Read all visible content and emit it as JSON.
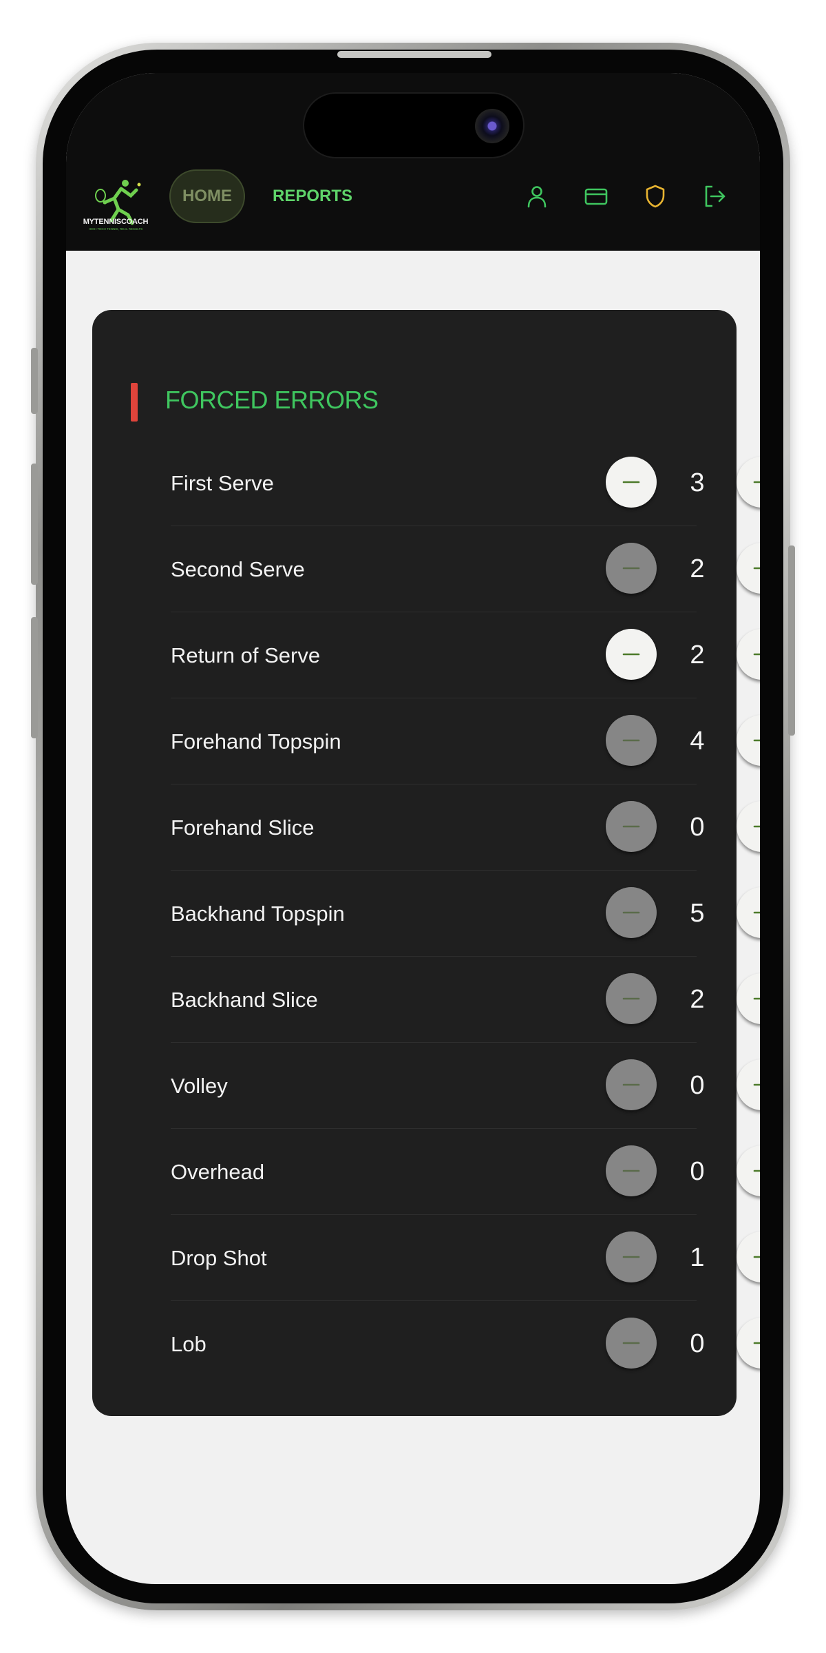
{
  "app": {
    "brand": "MYTENNISCOACH",
    "tagline": "HIGH-TECH TENNIS, REAL RESULTS"
  },
  "nav": {
    "home_label": "HOME",
    "reports_label": "REPORTS",
    "icons": [
      "user-icon",
      "credit-card-icon",
      "shield-icon",
      "logout-icon"
    ]
  },
  "colors": {
    "accent_green": "#3fc65f",
    "section_marker_red": "#e0443b",
    "shield_yellow": "#e8b431",
    "card_bg": "#1f1f1f"
  },
  "section": {
    "title": "FORCED ERRORS",
    "rows": [
      {
        "label": "First Serve",
        "count": "3",
        "minus_enabled": true
      },
      {
        "label": "Second Serve",
        "count": "2",
        "minus_enabled": false
      },
      {
        "label": "Return of Serve",
        "count": "2",
        "minus_enabled": true
      },
      {
        "label": "Forehand Topspin",
        "count": "4",
        "minus_enabled": false
      },
      {
        "label": "Forehand Slice",
        "count": "0",
        "minus_enabled": false
      },
      {
        "label": "Backhand Topspin",
        "count": "5",
        "minus_enabled": false
      },
      {
        "label": "Backhand Slice",
        "count": "2",
        "minus_enabled": false
      },
      {
        "label": "Volley",
        "count": "0",
        "minus_enabled": false
      },
      {
        "label": "Overhead",
        "count": "0",
        "minus_enabled": false
      },
      {
        "label": "Drop Shot",
        "count": "1",
        "minus_enabled": false
      },
      {
        "label": "Lob",
        "count": "0",
        "minus_enabled": false
      }
    ]
  }
}
